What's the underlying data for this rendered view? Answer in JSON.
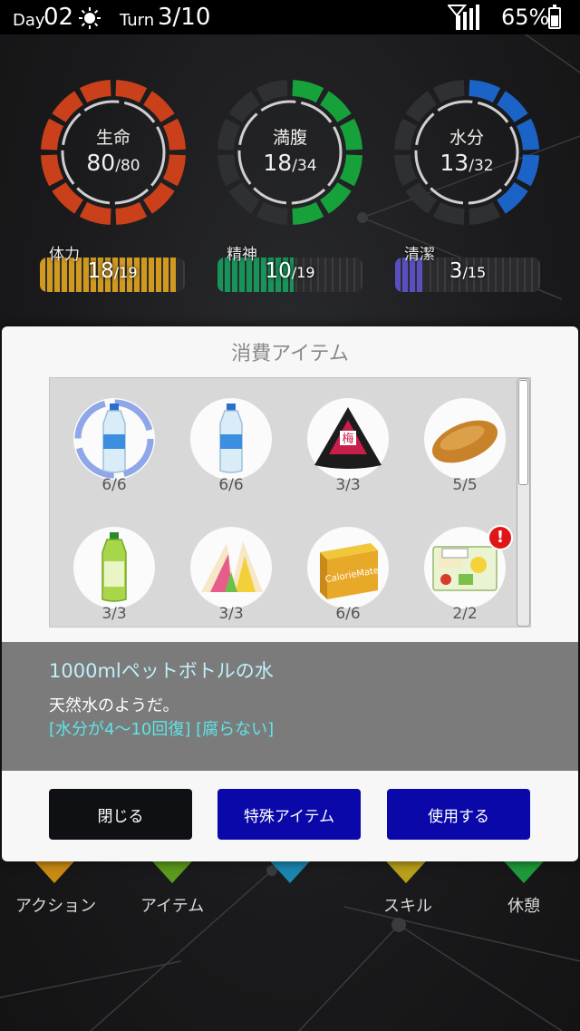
{
  "status": {
    "day_label": "Day",
    "day_value": "02",
    "turn_label": "Turn",
    "turn_value": "3/10",
    "battery": "65%",
    "weather_icon": "sun-icon"
  },
  "stats": {
    "life": {
      "label": "生命",
      "cur": "80",
      "max": "/80",
      "color": "#c9401a"
    },
    "fullness": {
      "label": "満腹",
      "cur": "18",
      "max": "/34",
      "color": "#17a13a"
    },
    "water": {
      "label": "水分",
      "cur": "13",
      "max": "/32",
      "color": "#1c63c8"
    },
    "stamina": {
      "label": "体力",
      "cur": "18",
      "max": "/19",
      "color": "#d19a1e",
      "level": 0.947
    },
    "mind": {
      "label": "精神",
      "cur": "10",
      "max": "/19",
      "color": "#16945a",
      "level": 0.526
    },
    "clean": {
      "label": "清潔",
      "cur": "3",
      "max": "/15",
      "color": "#5a4fc0",
      "level": 0.2
    }
  },
  "nav": {
    "action": "アクション",
    "item": "アイテム",
    "skill": "スキル",
    "rest": "休憩"
  },
  "modal": {
    "title": "消費アイテム",
    "items": [
      {
        "icon": "water-bottle-icon",
        "count": "6/6"
      },
      {
        "icon": "water-bottle-icon",
        "count": "6/6"
      },
      {
        "icon": "onigiri-icon",
        "count": "3/3"
      },
      {
        "icon": "bread-icon",
        "count": "5/5"
      },
      {
        "icon": "green-tea-bottle-icon",
        "count": "3/3"
      },
      {
        "icon": "sandwich-icon",
        "count": "3/3"
      },
      {
        "icon": "calorie-mate-icon",
        "count": "6/6"
      },
      {
        "icon": "bento-icon",
        "count": "2/2",
        "badge": "!"
      }
    ],
    "onigiri_mark": "梅",
    "box_brand": "CalorieMate",
    "description": {
      "name": "1000mlペットボトルの水",
      "text": "天然水のようだ。",
      "effect": "[水分が4～10回復] [腐らない]"
    },
    "buttons": {
      "close": "閉じる",
      "special": "特殊アイテム",
      "use": "使用する"
    }
  }
}
